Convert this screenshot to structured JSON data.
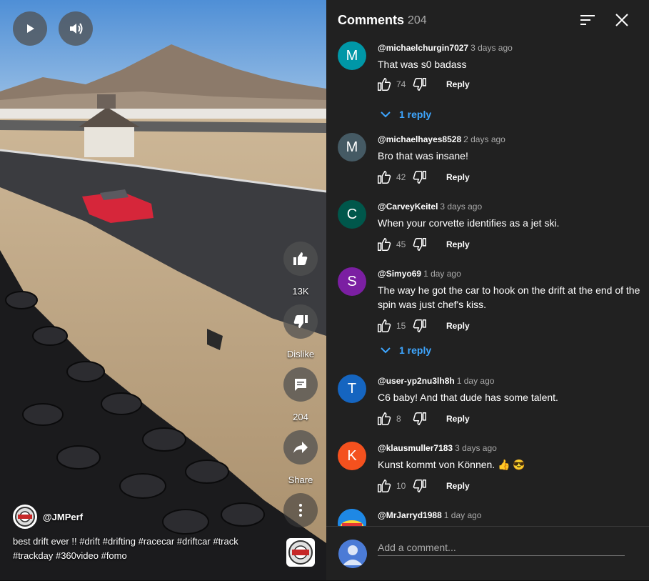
{
  "video": {
    "channel": "@JMPerf",
    "caption": "best drift ever !! #drift #drifting #racecar #driftcar #track #trackday #360video #fomo",
    "likes": "13K",
    "dislike_label": "Dislike",
    "comment_count": "204",
    "share_label": "Share",
    "logo_text": "JMPerf"
  },
  "panel": {
    "title": "Comments",
    "count": "204"
  },
  "comments": [
    {
      "avatar_letter": "M",
      "avatar_color": "#0097a7",
      "author": "@michaelchurgin7027",
      "time": "3 days ago",
      "text": "That was s0 badass",
      "likes": "74",
      "reply": "Reply",
      "replies": "1 reply"
    },
    {
      "avatar_letter": "M",
      "avatar_color": "#455a64",
      "author": "@michaelhayes8528",
      "time": "2 days ago",
      "text": "Bro that was insane!",
      "likes": "42",
      "reply": "Reply"
    },
    {
      "avatar_letter": "C",
      "avatar_color": "#00574b",
      "author": "@CarveyKeitel",
      "time": "3 days ago",
      "text": "When your corvette identifies as a jet ski.",
      "likes": "45",
      "reply": "Reply"
    },
    {
      "avatar_letter": "S",
      "avatar_color": "#7b1fa2",
      "author": "@Simyo69",
      "time": "1 day ago",
      "text": "The way he got the car to hook on the drift at the end of the spin was just chef's kiss.",
      "likes": "15",
      "reply": "Reply",
      "replies": "1 reply"
    },
    {
      "avatar_letter": "T",
      "avatar_color": "#1565c0",
      "author": "@user-yp2nu3lh8h",
      "time": "1 day ago",
      "text": "C6 baby! And that dude has some talent.",
      "likes": "8",
      "reply": "Reply"
    },
    {
      "avatar_letter": "K",
      "avatar_color": "#f4511e",
      "author": "@klausmuller7183",
      "time": "3 days ago",
      "text": "Kunst kommt von Können. 👍 😎",
      "likes": "10",
      "reply": "Reply"
    },
    {
      "avatar_letter": "",
      "avatar_color": "#1e88e5",
      "author": "@MrJarryd1988",
      "time": "1 day ago",
      "text": "",
      "likes": "",
      "reply": ""
    }
  ],
  "add_comment": {
    "placeholder": "Add a comment..."
  }
}
